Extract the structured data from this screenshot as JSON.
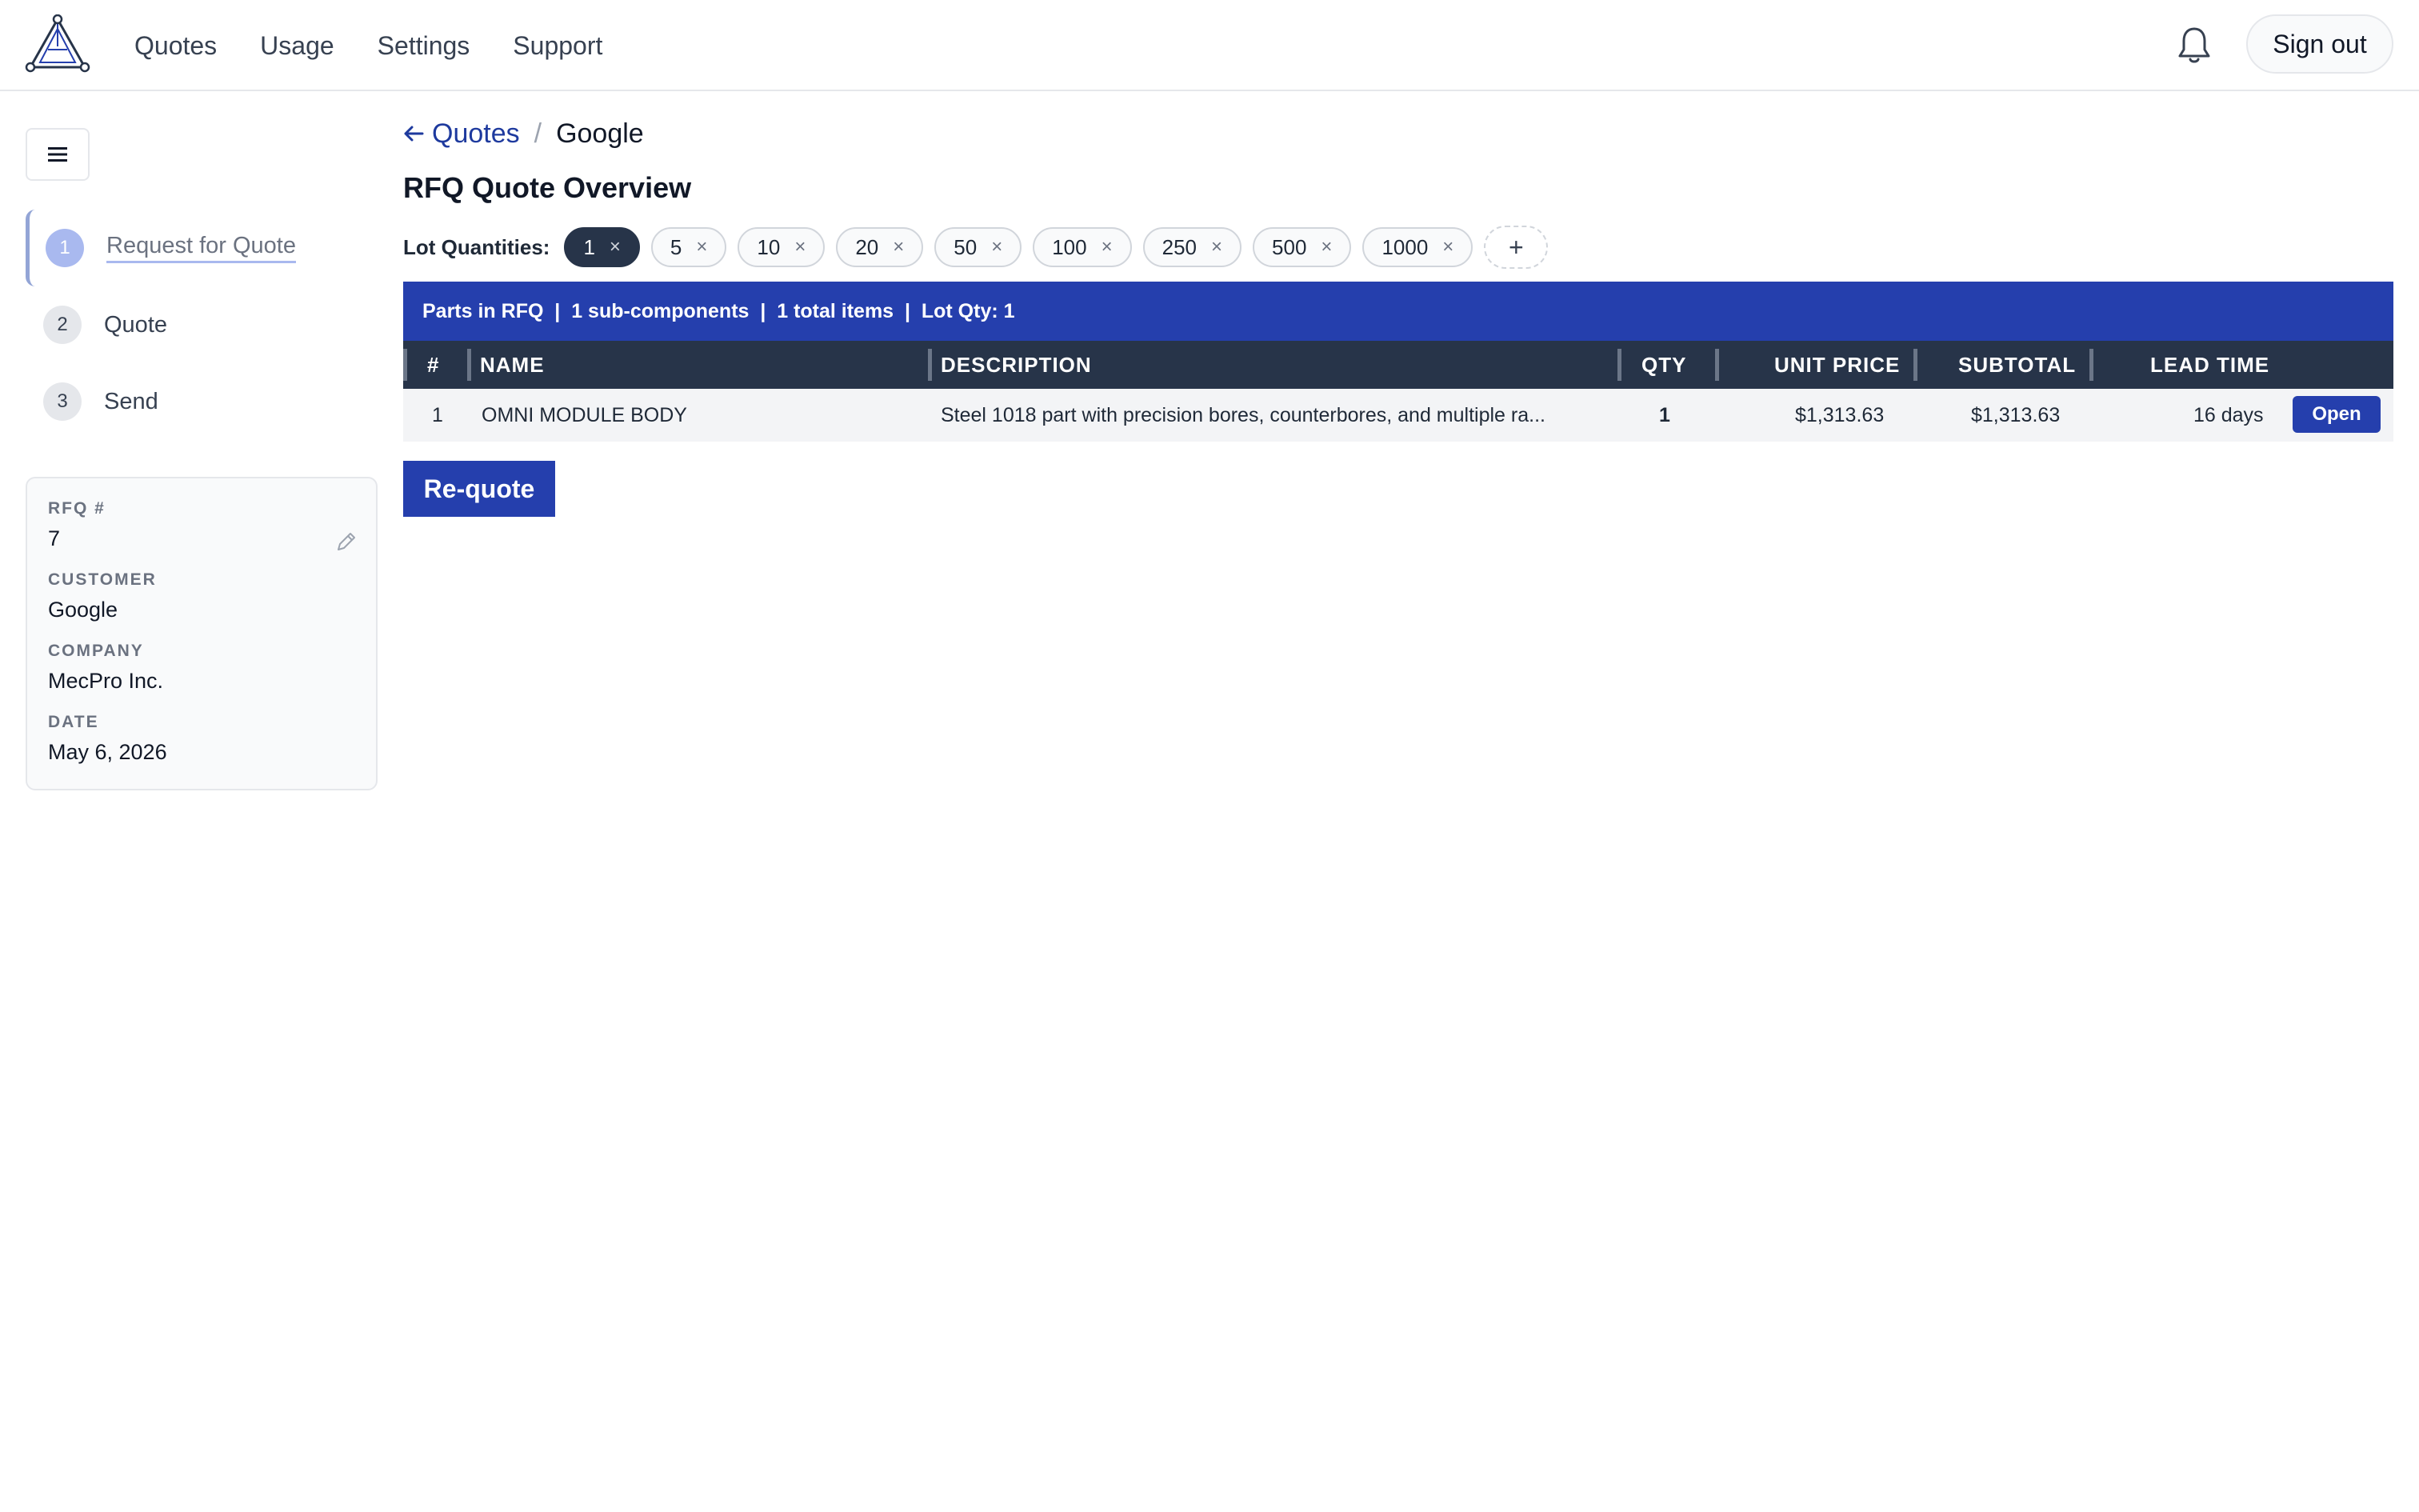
{
  "nav": {
    "logo_icon": "triangle-logo-icon",
    "items": [
      {
        "label": "Quotes"
      },
      {
        "label": "Usage"
      },
      {
        "label": "Settings"
      },
      {
        "label": "Support"
      }
    ],
    "bell_icon": "bell-icon",
    "sign_out_label": "Sign out"
  },
  "sidebar": {
    "menu_icon": "hamburger-menu-icon",
    "steps": [
      {
        "number": "1",
        "label": "Request for Quote",
        "active": true
      },
      {
        "number": "2",
        "label": "Quote",
        "active": false
      },
      {
        "number": "3",
        "label": "Send",
        "active": false
      }
    ],
    "info": {
      "rfq_label": "RFQ #",
      "rfq_value": "7",
      "customer_label": "CUSTOMER",
      "customer_value": "Google",
      "company_label": "COMPANY",
      "company_value": "MecPro Inc.",
      "date_label": "DATE",
      "date_value": "May 6, 2026",
      "edit_icon": "pencil-icon"
    }
  },
  "breadcrumb": {
    "back_label": "Quotes",
    "separator": "/",
    "current": "Google"
  },
  "page_title": "RFQ Quote Overview",
  "lot_quantities": {
    "label": "Lot Quantities:",
    "chips": [
      {
        "value": "1",
        "selected": true
      },
      {
        "value": "5",
        "selected": false
      },
      {
        "value": "10",
        "selected": false
      },
      {
        "value": "20",
        "selected": false
      },
      {
        "value": "50",
        "selected": false
      },
      {
        "value": "100",
        "selected": false
      },
      {
        "value": "250",
        "selected": false
      },
      {
        "value": "500",
        "selected": false
      },
      {
        "value": "1000",
        "selected": false
      }
    ],
    "remove_glyph": "×",
    "add_glyph": "+"
  },
  "summary": "Parts in RFQ  |  1 sub-components  |  1 total items  |  Lot Qty: 1",
  "table": {
    "headers": {
      "num": "#",
      "name": "NAME",
      "description": "DESCRIPTION",
      "qty": "QTY",
      "unit_price": "UNIT PRICE",
      "subtotal": "SUBTOTAL",
      "lead_time": "LEAD TIME"
    },
    "rows": [
      {
        "num": "1",
        "name": "OMNI MODULE BODY",
        "description": "Steel 1018 part with precision bores, counterbores, and multiple ra...",
        "qty": "1",
        "unit_price": "$1,313.63",
        "subtotal": "$1,313.63",
        "lead_time": "16 days",
        "action": "Open"
      }
    ]
  },
  "requote_label": "Re-quote",
  "colors": {
    "primary": "#253fad",
    "header_dark": "#273449",
    "step_active": "#a9b9ef"
  }
}
